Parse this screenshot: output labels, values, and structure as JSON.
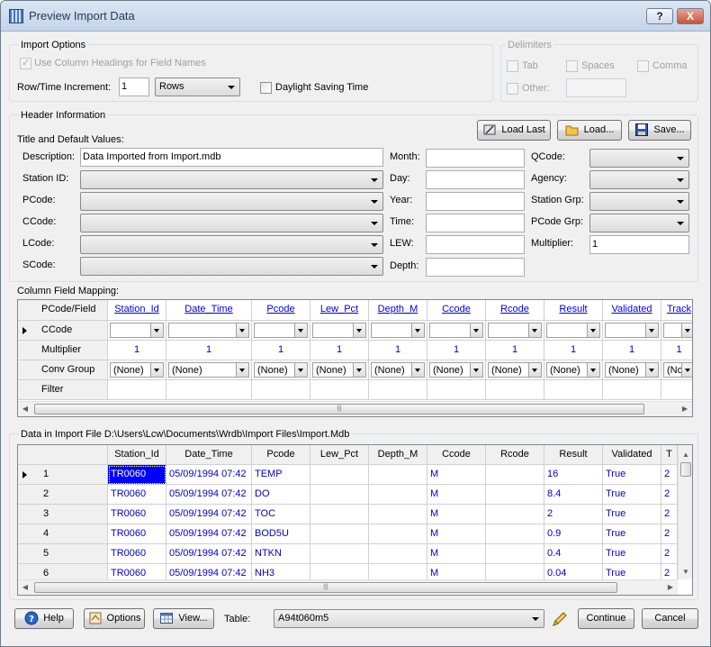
{
  "window": {
    "title": "Preview Import Data",
    "help_btn": "?",
    "close_btn": "X"
  },
  "import_options": {
    "title": "Import Options",
    "use_headings_label": "Use Column Headings for Field Names",
    "row_time_label": "Row/Time Increment:",
    "row_time_value": "1",
    "increment_unit": "Rows",
    "dst_label": "Daylight Saving Time"
  },
  "delimiters": {
    "title": "Delimiters",
    "tab": "Tab",
    "spaces": "Spaces",
    "comma": "Comma",
    "other": "Other:"
  },
  "header": {
    "title": "Header Information",
    "title_defaults": "Title and Default Values:",
    "load_last": "Load Last",
    "load": "Load...",
    "save": "Save...",
    "labels": {
      "description": "Description:",
      "station_id": "Station ID:",
      "pcode": "PCode:",
      "ccode": "CCode:",
      "lcode": "LCode:",
      "scode": "SCode:",
      "month": "Month:",
      "day": "Day:",
      "year": "Year:",
      "time": "Time:",
      "lew": "LEW:",
      "depth": "Depth:",
      "qcode": "QCode:",
      "agency": "Agency:",
      "station_grp": "Station Grp:",
      "pcode_grp": "PCode Grp:",
      "multiplier": "Multiplier:"
    },
    "description_value": "Data Imported from Import.mdb",
    "multiplier_value": "1"
  },
  "mapping": {
    "title": "Column Field Mapping:",
    "row_labels": [
      "PCode/Field",
      "CCode",
      "Multiplier",
      "Conv Group",
      "Filter"
    ],
    "columns": [
      "Station_Id",
      "Date_Time",
      "Pcode",
      "Lew_Pct",
      "Depth_M",
      "Ccode",
      "Rcode",
      "Result",
      "Validated",
      "Track"
    ],
    "multipliers": [
      "1",
      "1",
      "1",
      "1",
      "1",
      "1",
      "1",
      "1",
      "1",
      "1"
    ],
    "conv_group": [
      "(None)",
      "(None)",
      "(None)",
      "(None)",
      "(None)",
      "(None)",
      "(None)",
      "(None)",
      "(None)",
      "(None"
    ]
  },
  "data": {
    "title": "Data in Import File D:\\Users\\Lcw\\Documents\\Wrdb\\Import Files\\Import.Mdb",
    "columns": [
      "Station_Id",
      "Date_Time",
      "Pcode",
      "Lew_Pct",
      "Depth_M",
      "Ccode",
      "Rcode",
      "Result",
      "Validated",
      "T"
    ],
    "rows": [
      {
        "n": "1",
        "cells": [
          "TR0060",
          "05/09/1994 07:42",
          "TEMP",
          "",
          "",
          "M",
          "",
          "16",
          "True",
          "2"
        ]
      },
      {
        "n": "2",
        "cells": [
          "TR0060",
          "05/09/1994 07:42",
          "DO",
          "",
          "",
          "M",
          "",
          "8.4",
          "True",
          "2"
        ]
      },
      {
        "n": "3",
        "cells": [
          "TR0060",
          "05/09/1994 07:42",
          "TOC",
          "",
          "",
          "M",
          "",
          "2",
          "True",
          "2"
        ]
      },
      {
        "n": "4",
        "cells": [
          "TR0060",
          "05/09/1994 07:42",
          "BOD5U",
          "",
          "",
          "M",
          "",
          "0.9",
          "True",
          "2"
        ]
      },
      {
        "n": "5",
        "cells": [
          "TR0060",
          "05/09/1994 07:42",
          "NTKN",
          "",
          "",
          "M",
          "",
          "0.4",
          "True",
          "2"
        ]
      },
      {
        "n": "6",
        "cells": [
          "TR0060",
          "05/09/1994 07:42",
          "NH3",
          "",
          "",
          "M",
          "",
          "0.04",
          "True",
          "2"
        ]
      }
    ]
  },
  "footer": {
    "help": "Help",
    "options": "Options",
    "view": "View...",
    "table_label": "Table:",
    "table_value": "A94t060m5",
    "continue": "Continue",
    "cancel": "Cancel"
  },
  "colors": {
    "link": "#0000e0",
    "data_text": "#0000c8",
    "selection": "#0000ff"
  }
}
